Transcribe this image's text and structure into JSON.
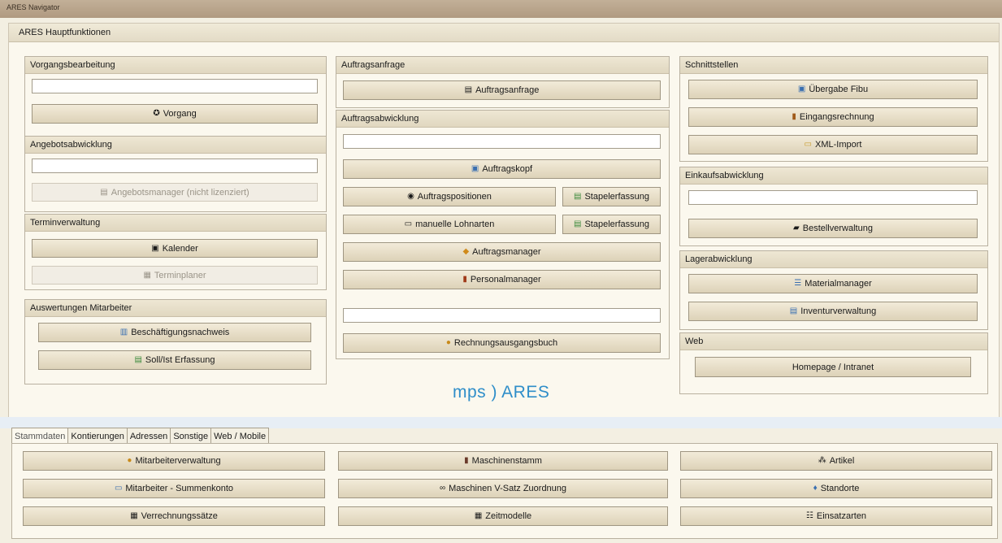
{
  "window": {
    "title": "ARES Navigator"
  },
  "main_header": "ARES Hauptfunktionen",
  "logo": "mps ) ARES",
  "groups": {
    "vorgang": {
      "title": "Vorgangsbearbeitung",
      "button": "Vorgang"
    },
    "angebot": {
      "title": "Angebotsabwicklung",
      "button": "Angebotsmanager (nicht lizenziert)"
    },
    "termin": {
      "title": "Terminverwaltung",
      "kalender": "Kalender",
      "terminplaner": "Terminplaner"
    },
    "auswertungen": {
      "title": "Auswertungen Mitarbeiter",
      "beschaeftigung": "Beschäftigungsnachweis",
      "sollist": "Soll/Ist Erfassung"
    },
    "auftragsanfrage": {
      "title": "Auftragsanfrage",
      "button": "Auftragsanfrage"
    },
    "auftragsabwicklung": {
      "title": "Auftragsabwicklung",
      "auftragskopf": "Auftragskopf",
      "auftragspositionen": "Auftragspositionen",
      "stapel1": "Stapelerfassung",
      "lohnarten": "manuelle Lohnarten",
      "stapel2": "Stapelerfassung",
      "auftragsmanager": "Auftragsmanager",
      "personalmanager": "Personalmanager",
      "rechnungsausgangsbuch": "Rechnungsausgangsbuch"
    },
    "schnittstellen": {
      "title": "Schnittstellen",
      "fibu": "Übergabe Fibu",
      "eingangsrechnung": "Eingangsrechnung",
      "xml": "XML-Import"
    },
    "einkauf": {
      "title": "Einkaufsabwicklung",
      "bestell": "Bestellverwaltung"
    },
    "lager": {
      "title": "Lagerabwicklung",
      "material": "Materialmanager",
      "inventur": "Inventurverwaltung"
    },
    "web": {
      "title": "Web",
      "homepage": "Homepage / Intranet"
    }
  },
  "tabs": [
    "Stammdaten",
    "Kontierungen",
    "Adressen",
    "Sonstige",
    "Web / Mobile"
  ],
  "stammdaten": {
    "mitarbeiterverwaltung": "Mitarbeiterverwaltung",
    "summenkonto": "Mitarbeiter - Summenkonto",
    "verrechnungssaetze": "Verrechnungssätze",
    "maschinenstamm": "Maschinenstamm",
    "vsatz": "Maschinen V-Satz Zuordnung",
    "zeitmodelle": "Zeitmodelle",
    "artikel": "Artikel",
    "standorte": "Standorte",
    "einsatzarten": "Einsatzarten"
  },
  "icons": {
    "vorgang": "vorgang-icon",
    "angebot": "angebotsmanager-icon",
    "kalender": "calendar-icon",
    "terminplaner": "terminplaner-icon",
    "beschaeftigung": "table-icon",
    "sollist": "chart-icon",
    "auftragsanfrage": "document-icon",
    "auftragskopf": "window-icon",
    "auftragspositionen": "circle-check-icon",
    "stapel": "stack-add-icon",
    "lohnarten": "keyboard-icon",
    "auftragsmanager": "box-icon",
    "personalmanager": "people-icon",
    "rechnung": "money-bag-icon",
    "fibu": "export-icon",
    "eingangsrechnung": "invoice-icon",
    "xml": "xml-icon",
    "bestell": "truck-icon",
    "material": "list-icon",
    "inventur": "inventory-icon",
    "mitarbeiter": "person-icon",
    "summenkonto": "window-icon",
    "verrechnung": "building-icon",
    "maschinenstamm": "machine-icon",
    "vsatz": "link-icon",
    "zeitmodelle": "grid-icon",
    "artikel": "articles-icon",
    "standorte": "pin-icon",
    "einsatzarten": "tree-icon"
  },
  "colors": {
    "logo": "#2f8ec9",
    "background": "#fbf8ee",
    "button": "#e6ddc7"
  }
}
